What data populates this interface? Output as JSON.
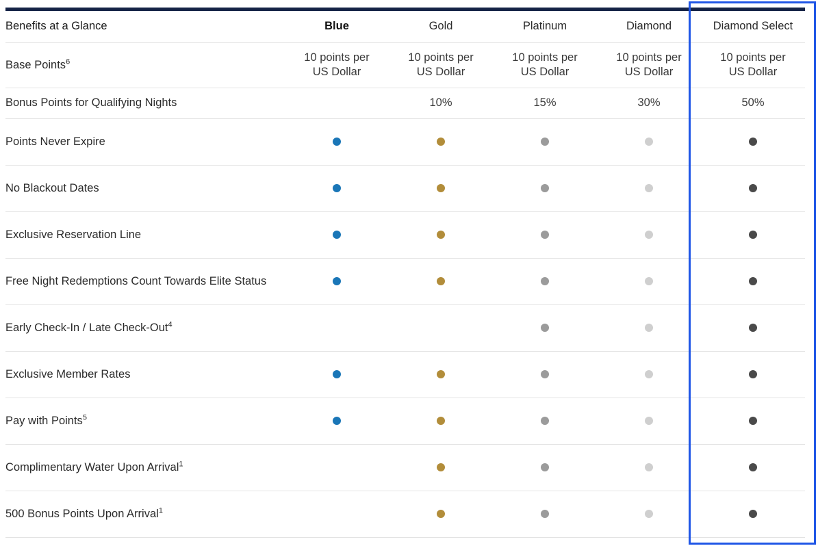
{
  "colors": {
    "header_bar": "#152346",
    "highlight_border": "#1f56e6",
    "tier_dots": {
      "blue": "#1a76b7",
      "gold": "#b28d3a",
      "platinum": "#9b9b9b",
      "diamond": "#cfcfcf",
      "diamond_select": "#4a4a4a"
    }
  },
  "table": {
    "header_label": "Benefits at a Glance",
    "tiers": [
      "Blue",
      "Gold",
      "Platinum",
      "Diamond",
      "Diamond Select"
    ],
    "tier_keys": [
      "blue",
      "gold",
      "platinum",
      "diamond",
      "diamond_select"
    ],
    "base_points": {
      "label": "Base Points",
      "footnote": "6",
      "line1": "10 points per",
      "line2": "US Dollar"
    },
    "bonus_points": {
      "label": "Bonus Points for Qualifying Nights",
      "values": [
        "",
        "10%",
        "15%",
        "30%",
        "50%"
      ]
    },
    "benefits": [
      {
        "label": "Points Never Expire",
        "footnote": "",
        "tiers": [
          true,
          true,
          true,
          true,
          true
        ]
      },
      {
        "label": "No Blackout Dates",
        "footnote": "",
        "tiers": [
          true,
          true,
          true,
          true,
          true
        ]
      },
      {
        "label": "Exclusive Reservation Line",
        "footnote": "",
        "tiers": [
          true,
          true,
          true,
          true,
          true
        ]
      },
      {
        "label": "Free Night Redemptions Count Towards Elite Status",
        "footnote": "",
        "tiers": [
          true,
          true,
          true,
          true,
          true
        ]
      },
      {
        "label": "Early Check-In / Late Check-Out",
        "footnote": "4",
        "tiers": [
          false,
          false,
          true,
          true,
          true
        ]
      },
      {
        "label": "Exclusive Member Rates",
        "footnote": "",
        "tiers": [
          true,
          true,
          true,
          true,
          true
        ]
      },
      {
        "label": "Pay with Points",
        "footnote": "5",
        "tiers": [
          true,
          true,
          true,
          true,
          true
        ]
      },
      {
        "label": "Complimentary Water Upon Arrival",
        "footnote": "1",
        "tiers": [
          false,
          true,
          true,
          true,
          true
        ]
      },
      {
        "label": "500 Bonus Points Upon Arrival",
        "footnote": "1",
        "tiers": [
          false,
          true,
          true,
          true,
          true
        ]
      }
    ]
  }
}
